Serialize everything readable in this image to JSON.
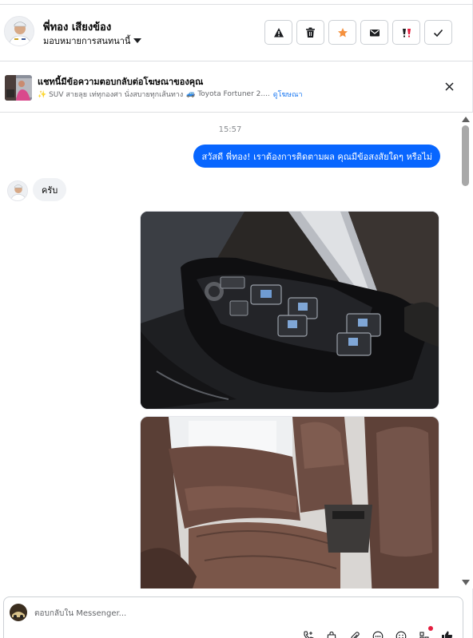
{
  "header": {
    "name": "พี่ทอง เสียงข้อง",
    "assign_label": "มอบหมายการสนทนานี้",
    "actions": [
      {
        "icon": "warning-icon"
      },
      {
        "icon": "trash-icon"
      },
      {
        "icon": "star-icon",
        "color": "#f5913e"
      },
      {
        "icon": "envelope-icon"
      },
      {
        "icon": "spam-icon",
        "color": "#e41e3f"
      },
      {
        "icon": "check-icon"
      }
    ]
  },
  "ad_bar": {
    "title": "แชทนี้มีข้อความตอบกลับต่อโฆษณาของคุณ",
    "ad_text_1": "✨ SUV สายลุย เท่ทุกองศา นั่งสบายทุกเส้นทาง",
    "ad_text_2": "🚙 Toyota Fortuner 2....",
    "view_ad_link": "ดูโฆษณา"
  },
  "conversation": {
    "timestamp": "15:57",
    "messages": [
      {
        "direction": "outgoing",
        "text": "สวัสดี พี่ทอง! เราต้องการติดตามผล คุณมีข้อสงสัยใดๆ หรือไม่"
      },
      {
        "direction": "incoming",
        "text": "ครับ"
      }
    ],
    "photos": [
      {
        "description_icon": "car-door-switch-photo"
      },
      {
        "description_icon": "car-rear-seat-photo"
      }
    ]
  },
  "composer": {
    "placeholder": "ตอบกลับใน Messenger..."
  },
  "colors": {
    "accent": "#0866ff",
    "link": "#1877f2",
    "incoming_bubble": "#f0f2f5"
  }
}
